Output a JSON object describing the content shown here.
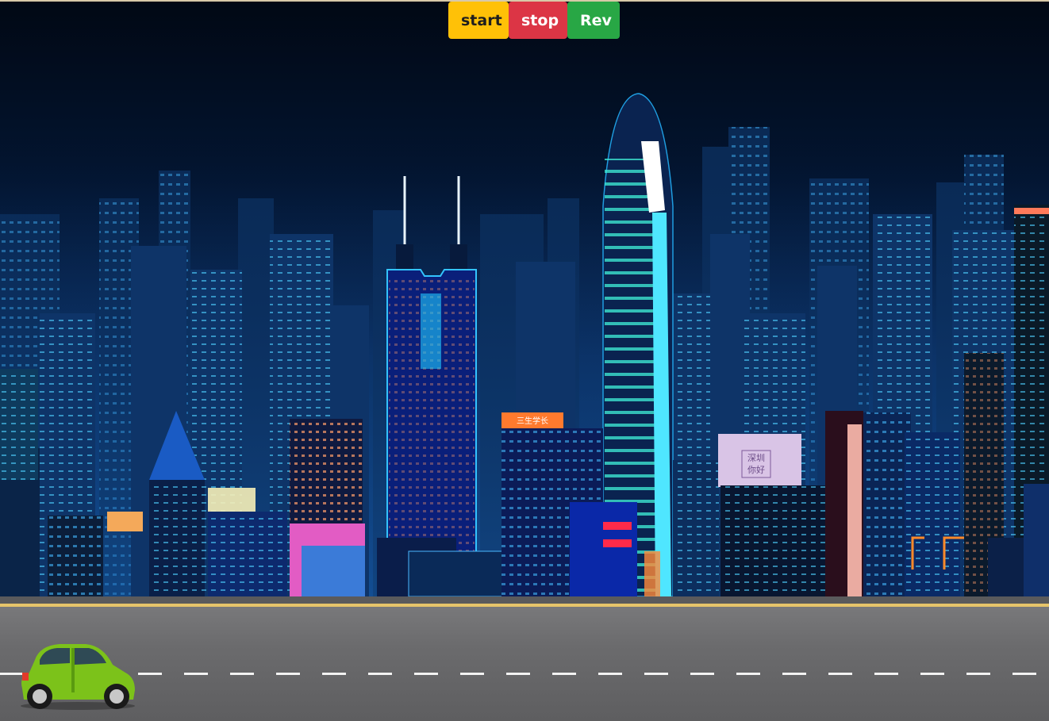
{
  "controls": {
    "start_label": "start",
    "stop_label": "stop",
    "rev_label": "Rev"
  },
  "scene": {
    "sign_orange": "三生学长",
    "sign_billboard_line1": "深圳",
    "sign_billboard_line2": "你好"
  },
  "colors": {
    "start": "#ffc107",
    "stop": "#dc3545",
    "rev": "#28a745",
    "car": "#7cc21a",
    "road_edge": "#e6c46a"
  },
  "icons": {
    "moon": "crescent-moon-icon",
    "car": "car-icon"
  }
}
